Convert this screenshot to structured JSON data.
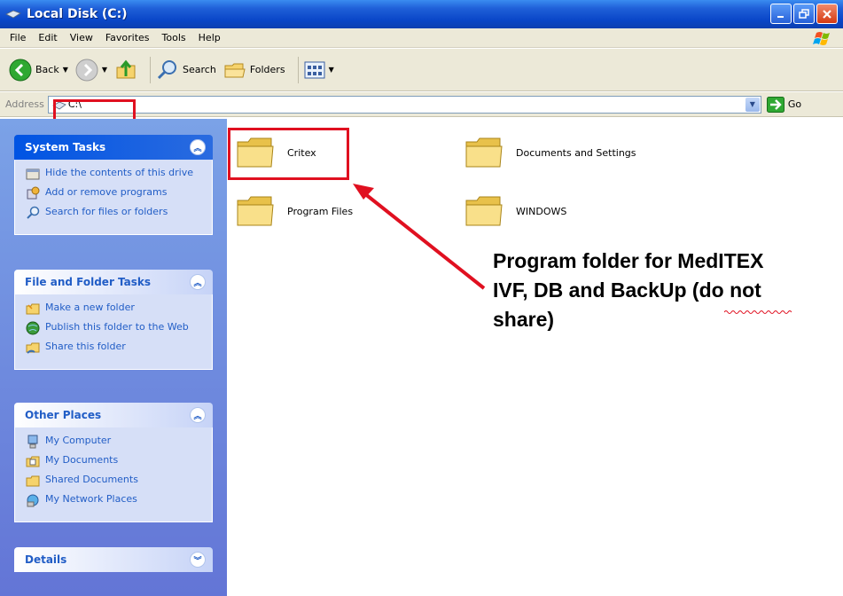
{
  "window": {
    "title": "Local Disk (C:)"
  },
  "menu": [
    "File",
    "Edit",
    "View",
    "Favorites",
    "Tools",
    "Help"
  ],
  "toolbar": {
    "back_label": "Back",
    "search_label": "Search",
    "folders_label": "Folders"
  },
  "address": {
    "label": "Address",
    "value": "C:\\",
    "go_label": "Go"
  },
  "system_tasks": {
    "title": "System Tasks",
    "items": [
      {
        "label": "Hide the contents of this drive",
        "icon": "hide-contents-icon"
      },
      {
        "label": "Add or remove programs",
        "icon": "add-remove-programs-icon"
      },
      {
        "label": "Search for files or folders",
        "icon": "search-icon"
      }
    ]
  },
  "file_folder_tasks": {
    "title": "File and Folder Tasks",
    "items": [
      {
        "label": "Make a new folder",
        "icon": "new-folder-icon"
      },
      {
        "label": "Publish this folder to the Web",
        "icon": "publish-web-icon"
      },
      {
        "label": "Share this folder",
        "icon": "share-folder-icon"
      }
    ]
  },
  "other_places": {
    "title": "Other Places",
    "items": [
      {
        "label": "My Computer",
        "icon": "my-computer-icon"
      },
      {
        "label": "My Documents",
        "icon": "my-documents-icon"
      },
      {
        "label": "Shared Documents",
        "icon": "shared-documents-icon"
      },
      {
        "label": "My Network Places",
        "icon": "network-places-icon"
      }
    ]
  },
  "details": {
    "title": "Details"
  },
  "folders": [
    "Critex",
    "Documents and Settings",
    "Program Files",
    "WINDOWS"
  ],
  "annotation": {
    "lines": [
      "Program folder for MedITEX",
      "IVF, DB and BackUp (do not",
      "share)"
    ]
  },
  "colors": {
    "highlight": "#e01020",
    "panel_link": "#215dc6",
    "title_bar": "#0a47c8"
  }
}
